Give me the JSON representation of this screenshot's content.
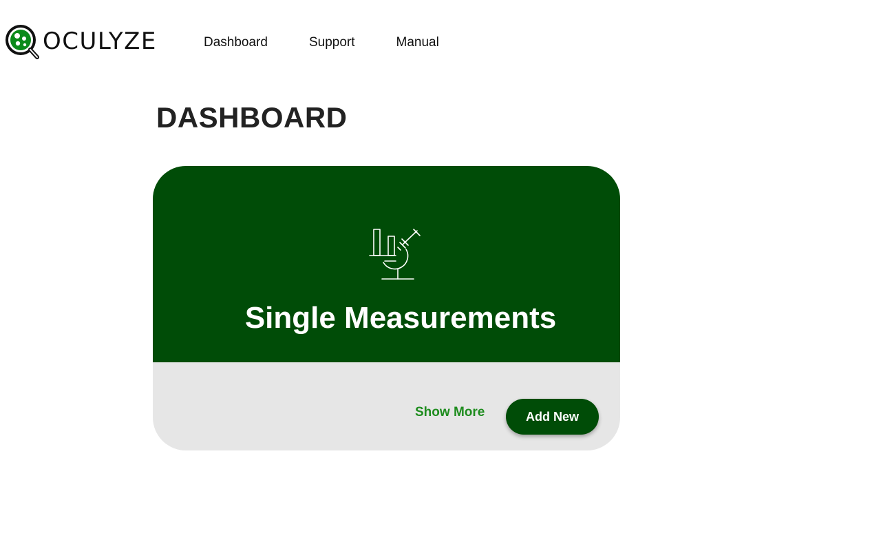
{
  "brand": {
    "name": "OCULYZE",
    "accent_color": "#0b8a1a",
    "logo_icon": "magnifier-cells-icon"
  },
  "nav": {
    "items": [
      {
        "label": "Dashboard"
      },
      {
        "label": "Support"
      },
      {
        "label": "Manual"
      }
    ]
  },
  "page": {
    "title": "DASHBOARD"
  },
  "card": {
    "icon": "microscope-chart-icon",
    "title": "Single Measurements",
    "show_more_label": "Show More",
    "add_new_label": "Add New",
    "primary_color": "#004c07",
    "footer_color": "#e6e6e6",
    "link_color": "#1e8c1e"
  }
}
